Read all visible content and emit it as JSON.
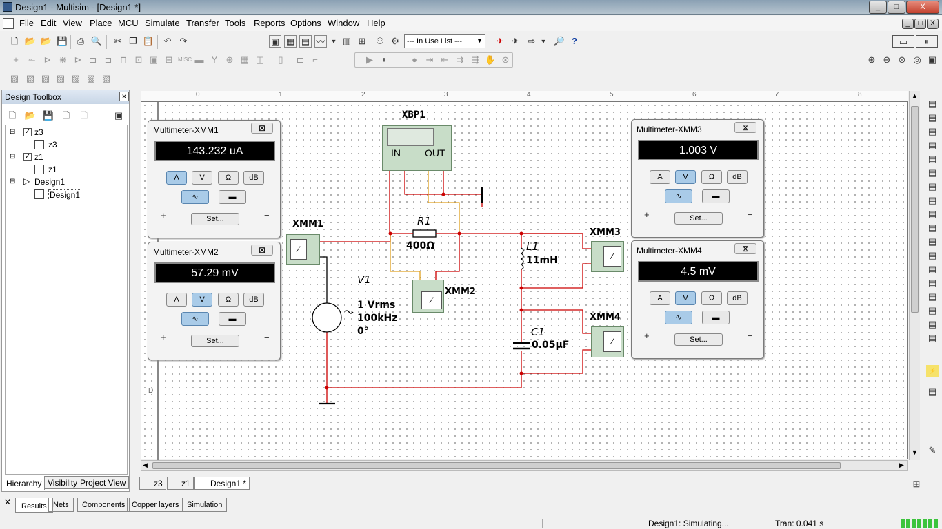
{
  "title": "Design1 - Multisim - [Design1 *]",
  "window_buttons": [
    "_",
    "□",
    "X"
  ],
  "mdi_buttons": [
    "_",
    "□",
    "X"
  ],
  "menu": [
    "File",
    "Edit",
    "View",
    "Place",
    "MCU",
    "Simulate",
    "Transfer",
    "Tools",
    "Reports",
    "Options",
    "Window",
    "Help"
  ],
  "in_use_list": "--- In Use List ---",
  "toolbox": {
    "title": "Design Toolbox",
    "close": "×",
    "tree": [
      "z3",
      "z3",
      "z1",
      "z1",
      "Design1",
      "Design1"
    ],
    "tabs": [
      "Hierarchy",
      "Visibility",
      "Project View"
    ]
  },
  "ruler": [
    "0",
    "1",
    "2",
    "3",
    "4",
    "5",
    "6",
    "7",
    "8"
  ],
  "row_label": "D",
  "multimeters": [
    {
      "title": "Multimeter-XMM1",
      "value": "143.232 uA",
      "active": "A"
    },
    {
      "title": "Multimeter-XMM2",
      "value": "57.29 mV",
      "active": "V"
    },
    {
      "title": "Multimeter-XMM3",
      "value": "1.003 V",
      "active": "V"
    },
    {
      "title": "Multimeter-XMM4",
      "value": "4.5 mV",
      "active": "V"
    }
  ],
  "mm_buttons": [
    "A",
    "V",
    "Ω",
    "dB"
  ],
  "mm_set": "Set...",
  "mm_close": "⊠",
  "plus": "+",
  "minus": "−",
  "circuit": {
    "xbp": "XBP1",
    "xbp_in": "IN",
    "xbp_out": "OUT",
    "r1": "R1",
    "r1_val": "400Ω",
    "l1": "L1",
    "l1_val": "11mH",
    "c1": "C1",
    "c1_val": "0.05µF",
    "v1": "V1",
    "v1_val1": "1 Vrms",
    "v1_val2": "100kHz",
    "v1_val3": "0°",
    "xmm1": "XMM1",
    "xmm2": "XMM2",
    "xmm3": "XMM3",
    "xmm4": "XMM4"
  },
  "sheet_tabs": [
    "z3",
    "z1",
    "Design1 *"
  ],
  "bottom_tabs": [
    "Results",
    "Nets",
    "Components",
    "Copper layers",
    "Simulation"
  ],
  "status": {
    "sim": "Design1: Simulating...",
    "tran": "Tran: 0.041 s"
  }
}
